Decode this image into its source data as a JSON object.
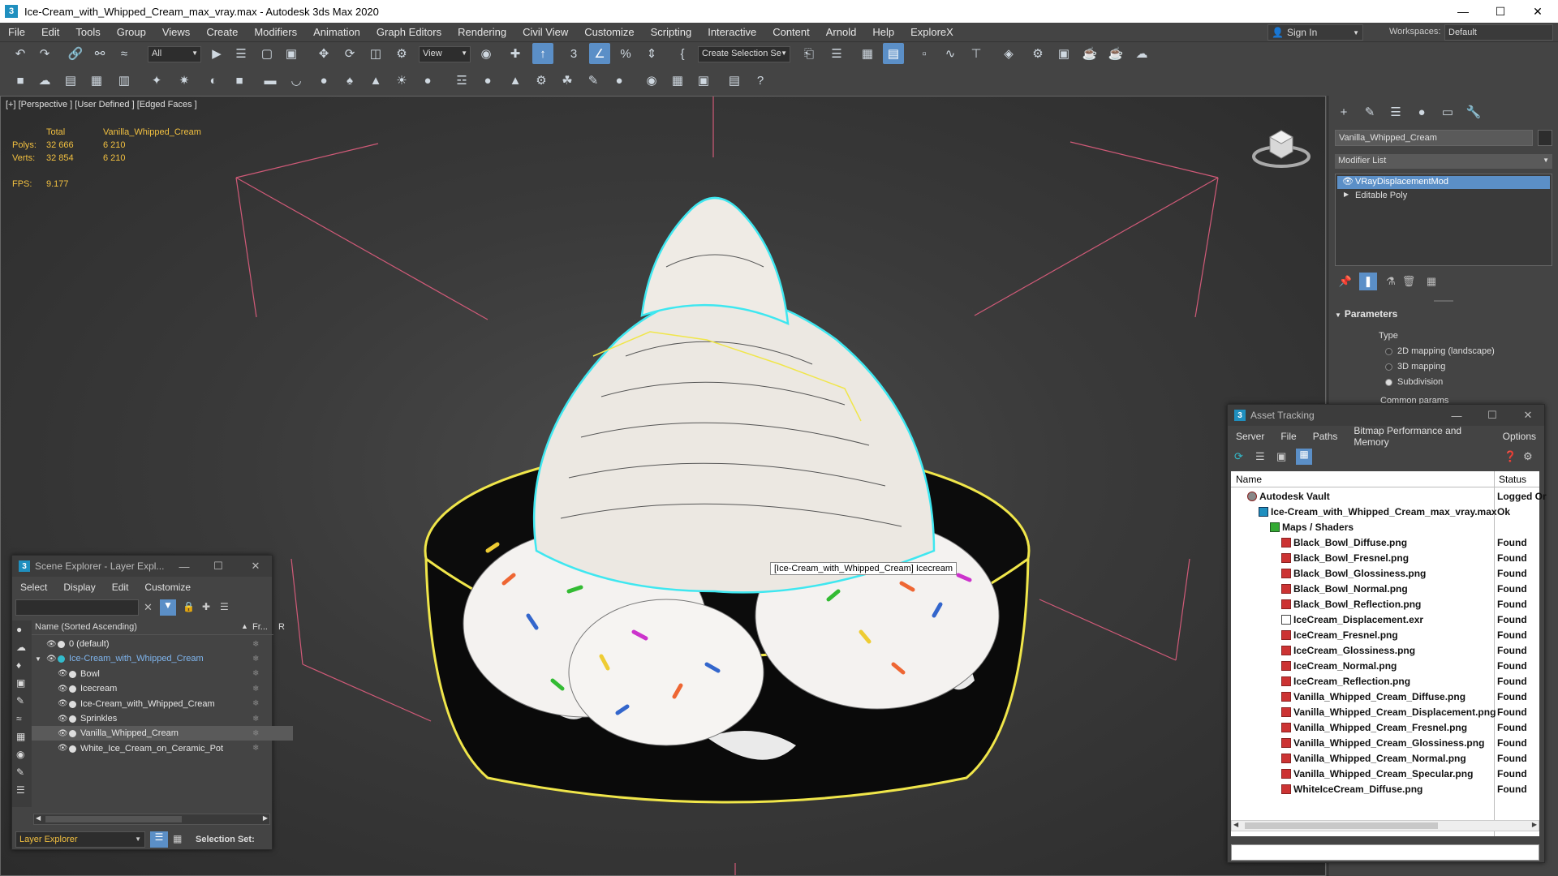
{
  "window": {
    "title": "Ice-Cream_with_Whipped_Cream_max_vray.max - Autodesk 3ds Max 2020",
    "app_icon": "3"
  },
  "menu": [
    "File",
    "Edit",
    "Tools",
    "Group",
    "Views",
    "Create",
    "Modifiers",
    "Animation",
    "Graph Editors",
    "Rendering",
    "Civil View",
    "Customize",
    "Scripting",
    "Interactive",
    "Content",
    "Arnold",
    "Help",
    "ExploreX"
  ],
  "account": {
    "sign_in": "Sign In",
    "workspaces_label": "Workspaces:",
    "workspace": "Default"
  },
  "toolbar": {
    "filter": "All",
    "ref_coord": "View",
    "selection_set": "Create Selection Se"
  },
  "viewport": {
    "label": "[+] [Perspective ] [User Defined ] [Edged Faces ]",
    "stats": {
      "col_total": "Total",
      "col_object": "Vanilla_Whipped_Cream",
      "polys_label": "Polys:",
      "polys_total": "32 666",
      "polys_object": "6 210",
      "verts_label": "Verts:",
      "verts_total": "32 854",
      "verts_object": "6 210",
      "fps_label": "FPS:",
      "fps_value": "9.177"
    },
    "tooltip": "[Ice-Cream_with_Whipped_Cream] Icecream"
  },
  "command_panel": {
    "object_name": "Vanilla_Whipped_Cream",
    "modifier_list": "Modifier List",
    "stack": [
      "VRayDisplacementMod",
      "Editable Poly"
    ],
    "rollout": "Parameters",
    "type_label": "Type",
    "type_options": [
      "2D mapping (landscape)",
      "3D mapping",
      "Subdivision"
    ],
    "selected_type": 2,
    "common_params": "Common params"
  },
  "scene_explorer": {
    "title": "Scene Explorer - Layer Expl...",
    "menu": [
      "Select",
      "Display",
      "Edit",
      "Customize"
    ],
    "col_name": "Name (Sorted Ascending)",
    "col_frozen": "Fr...",
    "col_r": "R",
    "rows": [
      {
        "name": "0 (default)",
        "indent": 0,
        "sel": false
      },
      {
        "name": "Ice-Cream_with_Whipped_Cream",
        "indent": 0,
        "sel": false
      },
      {
        "name": "Bowl",
        "indent": 1,
        "sel": false
      },
      {
        "name": "Icecream",
        "indent": 1,
        "sel": false
      },
      {
        "name": "Ice-Cream_with_Whipped_Cream",
        "indent": 1,
        "sel": false
      },
      {
        "name": "Sprinkles",
        "indent": 1,
        "sel": false
      },
      {
        "name": "Vanilla_Whipped_Cream",
        "indent": 1,
        "sel": true
      },
      {
        "name": "White_Ice_Cream_on_Ceramic_Pot",
        "indent": 1,
        "sel": false
      }
    ],
    "footer_mode": "Layer Explorer",
    "selection_set_label": "Selection Set:"
  },
  "asset_tracking": {
    "title": "Asset Tracking",
    "menu": [
      "Server",
      "File",
      "Paths",
      "Bitmap Performance and Memory",
      "Options"
    ],
    "col_name": "Name",
    "col_status": "Status",
    "rows": [
      {
        "name": "Autodesk Vault",
        "status": "Logged Or",
        "level": 0,
        "icon": "vault"
      },
      {
        "name": "Ice-Cream_with_Whipped_Cream_max_vray.max",
        "status": "Ok",
        "level": 1,
        "icon": "max"
      },
      {
        "name": "Maps / Shaders",
        "status": "",
        "level": 2,
        "icon": "fold"
      },
      {
        "name": "Black_Bowl_Diffuse.png",
        "status": "Found",
        "level": 3,
        "icon": "png"
      },
      {
        "name": "Black_Bowl_Fresnel.png",
        "status": "Found",
        "level": 3,
        "icon": "png"
      },
      {
        "name": "Black_Bowl_Glossiness.png",
        "status": "Found",
        "level": 3,
        "icon": "png"
      },
      {
        "name": "Black_Bowl_Normal.png",
        "status": "Found",
        "level": 3,
        "icon": "png"
      },
      {
        "name": "Black_Bowl_Reflection.png",
        "status": "Found",
        "level": 3,
        "icon": "png"
      },
      {
        "name": "IceCream_Displacement.exr",
        "status": "Found",
        "level": 3,
        "icon": "exr"
      },
      {
        "name": "IceCream_Fresnel.png",
        "status": "Found",
        "level": 3,
        "icon": "png"
      },
      {
        "name": "IceCream_Glossiness.png",
        "status": "Found",
        "level": 3,
        "icon": "png"
      },
      {
        "name": "IceCream_Normal.png",
        "status": "Found",
        "level": 3,
        "icon": "png"
      },
      {
        "name": "IceCream_Reflection.png",
        "status": "Found",
        "level": 3,
        "icon": "png"
      },
      {
        "name": "Vanilla_Whipped_Cream_Diffuse.png",
        "status": "Found",
        "level": 3,
        "icon": "png"
      },
      {
        "name": "Vanilla_Whipped_Cream_Displacement.png",
        "status": "Found",
        "level": 3,
        "icon": "png"
      },
      {
        "name": "Vanilla_Whipped_Cream_Fresnel.png",
        "status": "Found",
        "level": 3,
        "icon": "png"
      },
      {
        "name": "Vanilla_Whipped_Cream_Glossiness.png",
        "status": "Found",
        "level": 3,
        "icon": "png"
      },
      {
        "name": "Vanilla_Whipped_Cream_Normal.png",
        "status": "Found",
        "level": 3,
        "icon": "png"
      },
      {
        "name": "Vanilla_Whipped_Cream_Specular.png",
        "status": "Found",
        "level": 3,
        "icon": "png"
      },
      {
        "name": "WhiteIceCream_Diffuse.png",
        "status": "Found",
        "level": 3,
        "icon": "png"
      }
    ]
  },
  "colors": {
    "accent": "#5b8fc7",
    "selection_highlight": "#ffff33",
    "stats_text": "#f2c040",
    "grid_lines": "#d05a78"
  }
}
